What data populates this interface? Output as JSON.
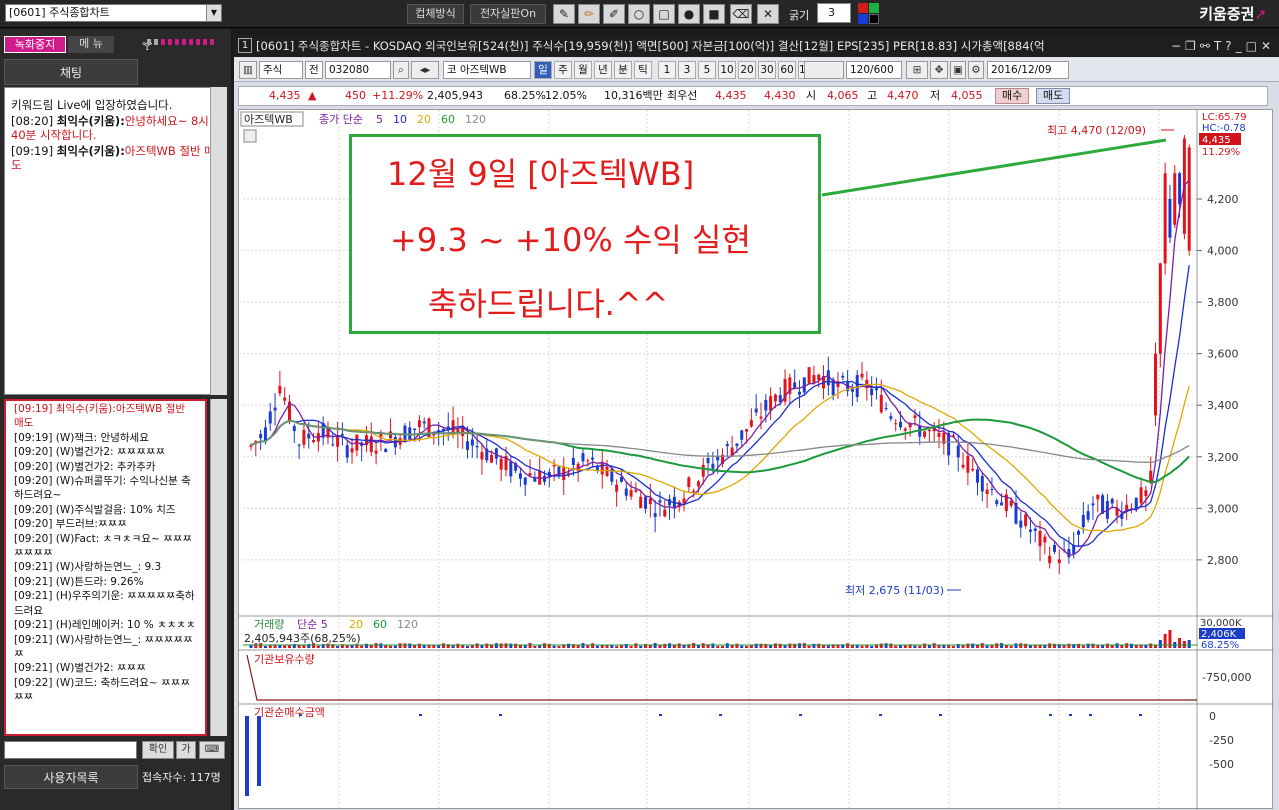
{
  "topbar": {
    "screen_select": "[0601] 주식종합차트",
    "btn_bargain": "컵체방식",
    "btn_fullscreen": "전자실판On",
    "thickness_label": "굵기",
    "thickness_value": "3",
    "brand": "키움증권"
  },
  "left": {
    "rec_button": "녹화중지",
    "menu_button": "메 뉴",
    "chat_tab": "채팅",
    "chat_messages": [
      {
        "text": "키워드림 Live에 입장하였습니다.",
        "red": false
      },
      {
        "time": "[08:20]",
        "user": "최익수(키움):",
        "msg": "안녕하세요~ 8시 40분 시작합니다."
      },
      {
        "time": "[09:19]",
        "user": "최익수(키움):",
        "msg": "아즈텍WB 절반 매도"
      }
    ],
    "chat_list": [
      "[09:19] 최익수(키움):아즈텍WB 절반 매도",
      "[09:19] (W)잭크: 안녕하세요",
      "[09:20] (W)별건가2: ㅉㅉㅉㅉㅉ",
      "[09:20] (W)별건가2: 추카추카",
      "[09:20] (W)슈퍼콜뚜기: 수익나신분 축하드려요~",
      "[09:20] (W)주식발걸음: 10% 치즈",
      "[09:20] 부드러브:ㅉㅉㅉ",
      "[09:20] (W)Fact: ㅊㅋㅊㅋ요~ ㅉㅉㅉㅉㅉㅉㅉ",
      "[09:21] (W)사랑하는연느_: 9.3",
      "[09:21] (W)튼드라: 9.26%",
      "[09:21] (H)우주의기운: ㅉㅉㅉㅉㅉ축하드려요",
      "[09:21] (H)레인메이커: 10 % ㅊㅊㅊㅊ",
      "[09:21] (W)사랑하는연느_: ㅉㅉㅉㅉㅉㅉ",
      "[09:21] (W)별건가2: ㅉㅉㅉ",
      "[09:22] (W)코드: 축하드려요~ ㅉㅉㅉㅉㅉ"
    ],
    "confirm_btn": "확인",
    "btn2": "가",
    "user_list_tab": "사용자목록",
    "user_count": "접속자수: 117명"
  },
  "window": {
    "number": "1",
    "title": "[0601] 주식종합차트 - KOSDAQ 외국인보유[524(천)] 주식수[19,959(천)] 액면[500] 자본금[100(억)] 결산[12월] EPS[235] PER[18.83] 시가총액[884(억"
  },
  "toolbar": {
    "market": "주식",
    "type": "전",
    "code": "032080",
    "stock_badge": "코",
    "stock_name": "아즈텍WB",
    "periods": [
      "일",
      "주",
      "월",
      "년",
      "분",
      "틱"
    ],
    "ticks": [
      "1",
      "3",
      "5",
      "10",
      "20",
      "30",
      "60",
      "120"
    ],
    "count": "120",
    "count_total": "/600",
    "date": "2016/12/09"
  },
  "quote": {
    "price": "4,435",
    "arrow": "▲",
    "change": "450",
    "change_pct": "+11.29%",
    "volume": "2,405,943",
    "vol_ratio": "68.25%",
    "turnover": "12.05%",
    "amount": "10,316백만",
    "pref_label": "최우선",
    "ask": "4,435",
    "bid": "4,430",
    "open_label": "시",
    "open": "4,065",
    "high_label": "고",
    "high": "4,470",
    "low_label": "저",
    "low": "4,055",
    "buy_btn": "매수",
    "sell_btn": "매도"
  },
  "legend": {
    "name": "아즈텍WB",
    "ma_label": "종가 단순",
    "ma": [
      "5",
      "10",
      "20",
      "60",
      "120"
    ],
    "ma_colors": [
      "#7c1fa0",
      "#1a2fd0",
      "#e0a800",
      "#1a9a3a",
      "#888888"
    ]
  },
  "annotation": {
    "line1": "12월 9일 [아즈텍WB]",
    "line2": "+9.3 ~ +10% 수익 실현",
    "line3": "축하드립니다.^^"
  },
  "price_axis": {
    "labels": [
      "4,200",
      "4,000",
      "3,800",
      "3,600",
      "3,400",
      "3,200",
      "3,000",
      "2,800"
    ],
    "lc": "LC:65.79",
    "hc": "HC:-0.78",
    "cur_pct": "11.29%",
    "cur_price": "4,435"
  },
  "markers": {
    "high": "최고 4,470 (12/09)",
    "low": "최저 2,675 (11/03)"
  },
  "volume": {
    "label": "거래량",
    "ma_label": "단순 5",
    "ma": [
      "20",
      "60",
      "120"
    ],
    "value": "2,405,943주(68,25%)",
    "axis_top": "30,000K",
    "badge": "2,406K",
    "badge_pct": "68.25%"
  },
  "inst_hold": {
    "label": "기관보유수량",
    "axis": "-750,000"
  },
  "inst_net": {
    "label": "기관순매수금액",
    "axis": [
      "0",
      "-250",
      "-500"
    ]
  }
}
